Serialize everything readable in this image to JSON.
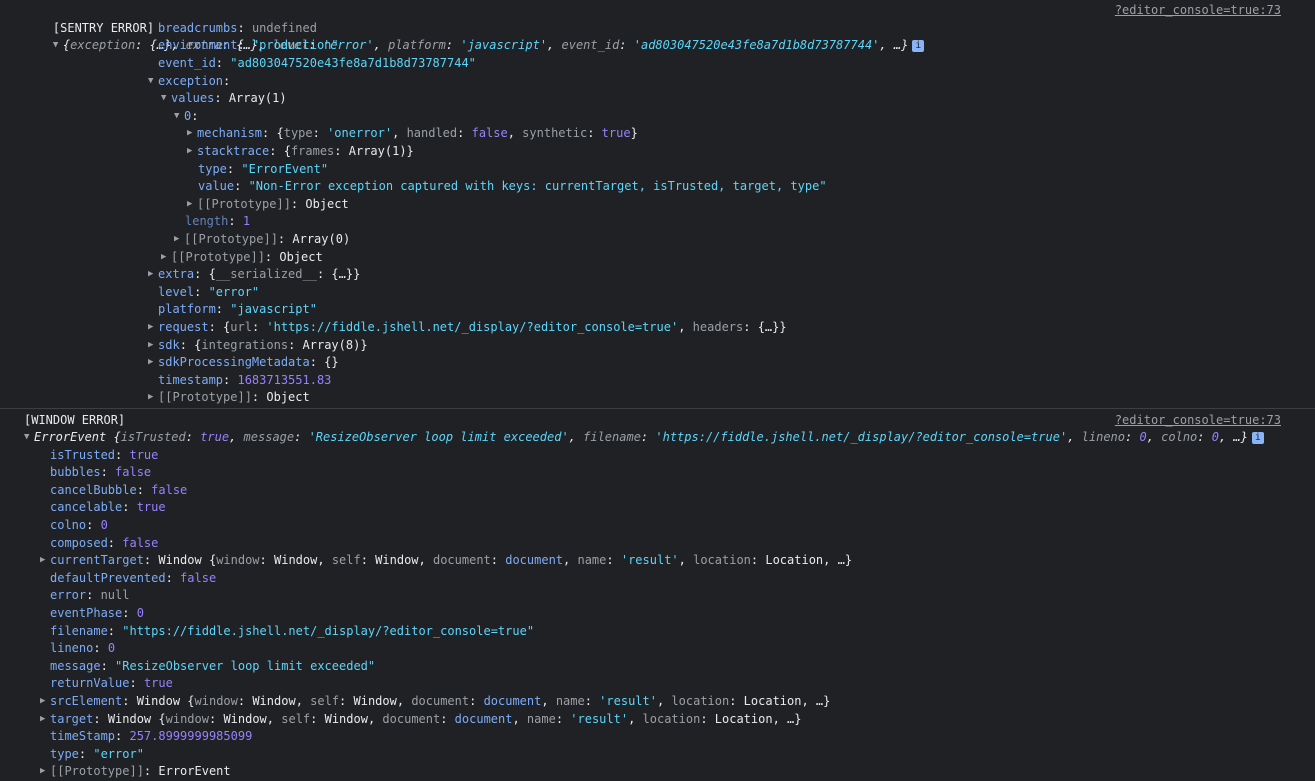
{
  "sentry": {
    "label": "[SENTRY ERROR]",
    "source": "?editor_console=true:73",
    "summary": {
      "k_exception": "exception",
      "v_exception": "{…}",
      "k_extra": "extra",
      "v_extra": "{…}",
      "k_level": "level",
      "v_level": "'error'",
      "k_platform": "platform",
      "v_platform": "'javascript'",
      "k_event_id": "event_id",
      "v_event_id": "'ad803047520e43fe8a7d1b8d73787744'",
      "more": "…}"
    },
    "breadcrumbs": {
      "key": "breadcrumbs",
      "value": "undefined"
    },
    "environment": {
      "key": "environment",
      "value": "\"production\""
    },
    "event_id": {
      "key": "event_id",
      "value": "\"ad803047520e43fe8a7d1b8d73787744\""
    },
    "exception": {
      "key": "exception"
    },
    "values": {
      "key": "values",
      "value": "Array(1)"
    },
    "zero": {
      "key": "0"
    },
    "mechanism": {
      "key": "mechanism",
      "k_type": "type",
      "v_type": "'onerror'",
      "k_handled": "handled",
      "v_handled": "false",
      "k_synthetic": "synthetic",
      "v_synthetic": "true"
    },
    "stacktrace": {
      "key": "stacktrace",
      "k_frames": "frames",
      "v_frames": "Array(1)"
    },
    "type": {
      "key": "type",
      "value": "\"ErrorEvent\""
    },
    "value": {
      "key": "value",
      "value": "\"Non-Error exception captured with keys: currentTarget, isTrusted, target, type\""
    },
    "proto_inner": {
      "key": "[[Prototype]]",
      "value": "Object"
    },
    "length": {
      "key": "length",
      "value": "1"
    },
    "proto_array": {
      "key": "[[Prototype]]",
      "value": "Array(0)"
    },
    "proto_exc": {
      "key": "[[Prototype]]",
      "value": "Object"
    },
    "extra": {
      "key": "extra",
      "k_serialized": "__serialized__",
      "v_serialized": "{…}"
    },
    "level": {
      "key": "level",
      "value": "\"error\""
    },
    "platform": {
      "key": "platform",
      "value": "\"javascript\""
    },
    "request": {
      "key": "request",
      "k_url": "url",
      "v_url": "'https://fiddle.jshell.net/_display/?editor_console=true'",
      "k_headers": "headers",
      "v_headers": "{…}"
    },
    "sdk": {
      "key": "sdk",
      "k_integrations": "integrations",
      "v_integrations": "Array(8)"
    },
    "sdkProcessingMetadata": {
      "key": "sdkProcessingMetadata",
      "value": "{}"
    },
    "timestamp": {
      "key": "timestamp",
      "value": "1683713551.83"
    },
    "proto_root": {
      "key": "[[Prototype]]",
      "value": "Object"
    }
  },
  "window_error": {
    "label": "[WINDOW ERROR]",
    "source": "?editor_console=true:73",
    "summary": {
      "class": "ErrorEvent",
      "k_isTrusted": "isTrusted",
      "v_isTrusted": "true",
      "k_message": "message",
      "v_message": "'ResizeObserver loop limit exceeded'",
      "k_filename": "filename",
      "v_filename": "'https://fiddle.jshell.net/_display/?editor_console=true'",
      "k_lineno": "lineno",
      "v_lineno": "0",
      "k_colno": "colno",
      "v_colno": "0",
      "more": "…}"
    },
    "isTrusted": {
      "key": "isTrusted",
      "value": "true"
    },
    "bubbles": {
      "key": "bubbles",
      "value": "false"
    },
    "cancelBubble": {
      "key": "cancelBubble",
      "value": "false"
    },
    "cancelable": {
      "key": "cancelable",
      "value": "true"
    },
    "colno": {
      "key": "colno",
      "value": "0"
    },
    "composed": {
      "key": "composed",
      "value": "false"
    },
    "currentTarget": {
      "key": "currentTarget",
      "prefix": "Window",
      "k_window": "window",
      "v_window": "Window",
      "k_self": "self",
      "v_self": "Window",
      "k_document": "document",
      "v_document": "document",
      "k_name": "name",
      "v_name": "'result'",
      "k_location": "location",
      "v_location": "Location",
      "more": "…}"
    },
    "defaultPrevented": {
      "key": "defaultPrevented",
      "value": "false"
    },
    "error": {
      "key": "error",
      "value": "null"
    },
    "eventPhase": {
      "key": "eventPhase",
      "value": "0"
    },
    "filename": {
      "key": "filename",
      "value": "\"https://fiddle.jshell.net/_display/?editor_console=true\""
    },
    "lineno": {
      "key": "lineno",
      "value": "0"
    },
    "message": {
      "key": "message",
      "value": "\"ResizeObserver loop limit exceeded\""
    },
    "returnValue": {
      "key": "returnValue",
      "value": "true"
    },
    "srcElement": {
      "key": "srcElement",
      "prefix": "Window",
      "k_window": "window",
      "v_window": "Window",
      "k_self": "self",
      "v_self": "Window",
      "k_document": "document",
      "v_document": "document",
      "k_name": "name",
      "v_name": "'result'",
      "k_location": "location",
      "v_location": "Location",
      "more": "…}"
    },
    "target": {
      "key": "target",
      "prefix": "Window",
      "k_window": "window",
      "v_window": "Window",
      "k_self": "self",
      "v_self": "Window",
      "k_document": "document",
      "v_document": "document",
      "k_name": "name",
      "v_name": "'result'",
      "k_location": "location",
      "v_location": "Location",
      "more": "…}"
    },
    "timeStamp": {
      "key": "timeStamp",
      "value": "257.8999999985099"
    },
    "type": {
      "key": "type",
      "value": "\"error\""
    },
    "proto": {
      "key": "[[Prototype]]",
      "value": "ErrorEvent"
    }
  },
  "icons": {
    "expanded": "triangle-down",
    "collapsed": "triangle-right",
    "info": "info-badge"
  },
  "colors": {
    "background": "#202124",
    "key": "#7cacf8",
    "string": "#5cd5fb",
    "number": "#9980ff",
    "dim": "#9aa0a6"
  }
}
